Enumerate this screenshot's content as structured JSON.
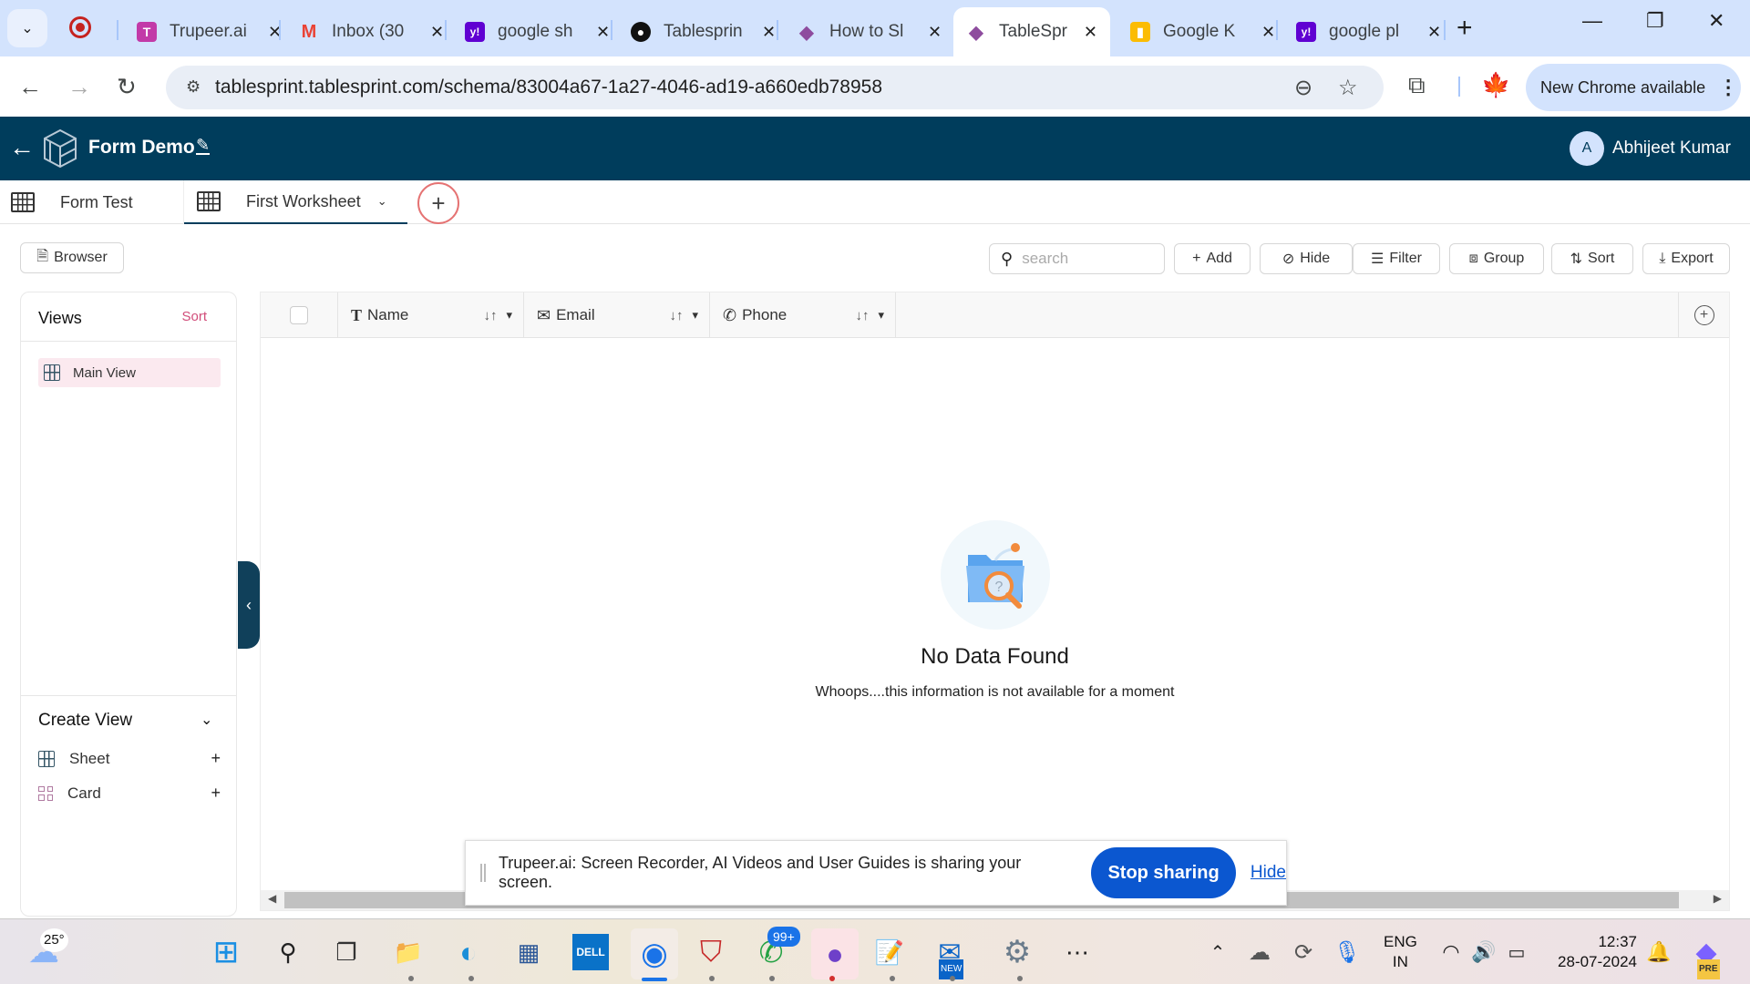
{
  "browser": {
    "tabs": [
      {
        "title": "Trupeer.ai",
        "favicon": "trupeer-icon",
        "color": "#c23aa8",
        "glyph": "T"
      },
      {
        "title": "Inbox (30",
        "favicon": "gmail-icon",
        "color": "#ea4335",
        "glyph": "M"
      },
      {
        "title": "google sh",
        "favicon": "yahoo-icon",
        "color": "#6001d2",
        "glyph": "y!"
      },
      {
        "title": "Tablesprin",
        "favicon": "github-icon",
        "color": "#111111",
        "glyph": "●"
      },
      {
        "title": "How to Sl",
        "favicon": "tablesprint-icon",
        "color": "#8e4c9e",
        "glyph": "◆"
      },
      {
        "title": "TableSprin",
        "favicon": "tablesprint-icon",
        "color": "#8e4c9e",
        "glyph": "◆",
        "active": true
      },
      {
        "title": "Google K",
        "favicon": "google-keep-icon",
        "color": "#fbbc04",
        "glyph": "▮"
      },
      {
        "title": "google pl",
        "favicon": "yahoo-icon",
        "color": "#6001d2",
        "glyph": "y!"
      }
    ],
    "url": "tablesprint.tablesprint.com/schema/83004a67-1a27-4046-ad19-a660edb78958",
    "update_label": "New Chrome available",
    "new_tab_glyph": "+",
    "minimize_glyph": "—",
    "restore_glyph": "❐",
    "close_glyph": "✕"
  },
  "app": {
    "title": "Form Demo",
    "user_initial": "A",
    "user_name": "Abhijeet Kumar",
    "brand_color": "#003d5c",
    "accent_color": "#d14d7a"
  },
  "worksheets": {
    "tabs": [
      {
        "label": "Form Test"
      },
      {
        "label": "First Worksheet",
        "active": true
      }
    ],
    "add_glyph": "+"
  },
  "toolbar": {
    "browser_label": "Browser",
    "search_placeholder": "search",
    "add_label": "Add",
    "hide_label": "Hide",
    "filter_label": "Filter",
    "group_label": "Group",
    "sort_label": "Sort",
    "export_label": "Export"
  },
  "sidebar": {
    "views_title": "Views",
    "views_sort": "Sort",
    "views": [
      {
        "label": "Main View"
      }
    ],
    "create_view_title": "Create View",
    "create_items": [
      {
        "label": "Sheet",
        "icon": "sheet-icon"
      },
      {
        "label": "Card",
        "icon": "card-icon"
      }
    ]
  },
  "grid": {
    "columns": [
      {
        "label": "Name",
        "icon": "text-type-icon",
        "glyph": "T"
      },
      {
        "label": "Email",
        "icon": "email-icon",
        "glyph": "✉"
      },
      {
        "label": "Phone",
        "icon": "phone-icon",
        "glyph": "✆"
      }
    ],
    "rows": [],
    "empty_title": "No Data Found",
    "empty_message": "Whoops....this information is not available for a moment"
  },
  "share_banner": {
    "message": "Trupeer.ai: Screen Recorder, AI Videos and User Guides is sharing your screen.",
    "stop_label": "Stop sharing",
    "hide_label": "Hide"
  },
  "taskbar": {
    "weather_temp": "25°",
    "whatsapp_badge": "99+",
    "outlook_badge": "NEW",
    "copilot_badge": "PRE",
    "language_line1": "ENG",
    "language_line2": "IN",
    "time": "12:37",
    "date": "28-07-2024"
  }
}
